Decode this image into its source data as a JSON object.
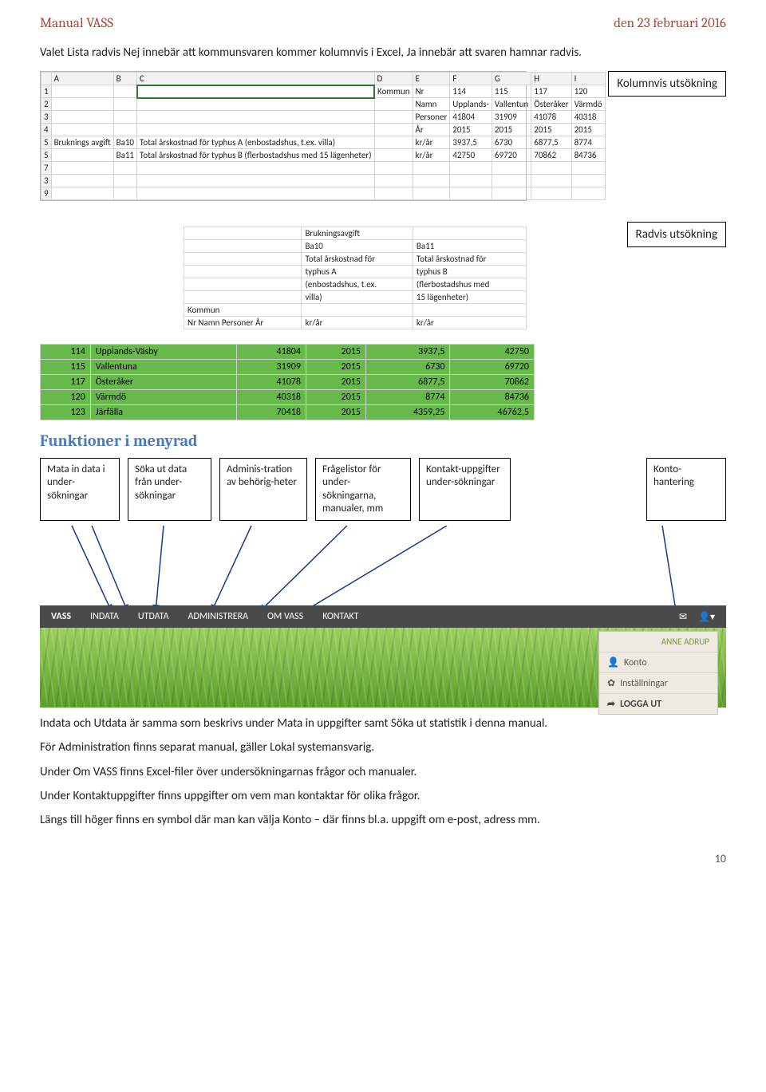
{
  "header": {
    "left": "Manual VASS",
    "right": "den 23 februari 2016"
  },
  "intro": "Valet Lista radvis Nej innebär att kommunsvaren kommer kolumnvis i Excel, Ja innebär att svaren hamnar radvis.",
  "label_kolumnvis": "Kolumnvis utsökning",
  "label_radvis": "Radvis utsökning",
  "excel1": {
    "cols": [
      "",
      "A",
      "B",
      "C",
      "D",
      "E",
      "F",
      "G",
      "H",
      "I"
    ],
    "rows": [
      [
        "1",
        "",
        "",
        "",
        "Kommun",
        "Nr",
        "114",
        "115",
        "117",
        "120"
      ],
      [
        "2",
        "",
        "",
        "",
        "",
        "Namn",
        "Upplands-",
        "Vallentun",
        "Österåker",
        "Värmdö"
      ],
      [
        "3",
        "",
        "",
        "",
        "",
        "Personer",
        "41804",
        "31909",
        "41078",
        "40318"
      ],
      [
        "4",
        "",
        "",
        "",
        "",
        "År",
        "2015",
        "2015",
        "2015",
        "2015"
      ],
      [
        "5",
        "Bruknings avgift",
        "Ba10",
        "Total årskostnad för typhus A (enbostadshus, t.ex. villa)",
        "",
        "kr/år",
        "3937,5",
        "6730",
        "6877,5",
        "8774"
      ],
      [
        "5",
        "",
        "Ba11",
        "Total årskostnad för typhus B (flerbostadshus med 15 lägenheter)",
        "",
        "kr/år",
        "42750",
        "69720",
        "70862",
        "84736"
      ],
      [
        "7",
        "",
        "",
        "",
        "",
        "",
        "",
        "",
        "",
        ""
      ],
      [
        "3",
        "",
        "",
        "",
        "",
        "",
        "",
        "",
        "",
        ""
      ],
      [
        "9",
        "",
        "",
        "",
        "",
        "",
        "",
        "",
        "",
        ""
      ]
    ]
  },
  "mini": {
    "rows": [
      [
        "",
        "Brukningsavgift",
        ""
      ],
      [
        "",
        "Ba10",
        "Ba11"
      ],
      [
        "",
        "Total årskostnad för",
        "Total årskostnad för"
      ],
      [
        "",
        "typhus A",
        "typhus B"
      ],
      [
        "",
        "(enbostadshus, t.ex.",
        "(flerbostadshus med"
      ],
      [
        "",
        "villa)",
        "15 lägenheter)"
      ],
      [
        "Kommun",
        "",
        ""
      ],
      [
        "Nr   Namn            Personer  År",
        "kr/år",
        "kr/år"
      ]
    ]
  },
  "greentable": {
    "rows": [
      {
        "nr": "114",
        "namn": "Upplands-Väsby",
        "pers": "41804",
        "ar": "2015",
        "v1": "3937,5",
        "v2": "42750"
      },
      {
        "nr": "115",
        "namn": "Vallentuna",
        "pers": "31909",
        "ar": "2015",
        "v1": "6730",
        "v2": "69720"
      },
      {
        "nr": "117",
        "namn": "Österåker",
        "pers": "41078",
        "ar": "2015",
        "v1": "6877,5",
        "v2": "70862"
      },
      {
        "nr": "120",
        "namn": "Värmdö",
        "pers": "40318",
        "ar": "2015",
        "v1": "8774",
        "v2": "84736"
      },
      {
        "nr": "123",
        "namn": "Järfälla",
        "pers": "70418",
        "ar": "2015",
        "v1": "4359,25",
        "v2": "46762,5"
      }
    ]
  },
  "heading_funktioner": "Funktioner i menyrad",
  "boxes": [
    "Mata in data i under-sökningar",
    "Söka ut data från under-sökningar",
    "Adminis-tration av behörig-heter",
    "Frågelistor för under-sökningarna, manualer, mm",
    "Kontakt-uppgifter under-sökningar",
    "Konto-hantering"
  ],
  "menu": {
    "brand": "VASS",
    "items": [
      "INDATA",
      "UTDATA",
      "ADMINISTRERA",
      "OM VASS",
      "KONTAKT"
    ],
    "user": "ANNE ADRUP",
    "usermenu": [
      "Konto",
      "Inställningar",
      "LOGGA UT"
    ]
  },
  "para": [
    "Indata och Utdata är samma som beskrivs under Mata in uppgifter samt Söka ut statistik i denna manual.",
    "För Administration finns separat manual, gäller Lokal systemansvarig.",
    "Under Om VASS finns Excel-filer över undersökningarnas frågor och manualer.",
    "Under Kontaktuppgifter finns uppgifter om vem man kontaktar för olika frågor.",
    "Längs till höger finns en symbol där man kan välja Konto – där finns bl.a. uppgift om e-post, adress mm."
  ],
  "pagenum": "10"
}
